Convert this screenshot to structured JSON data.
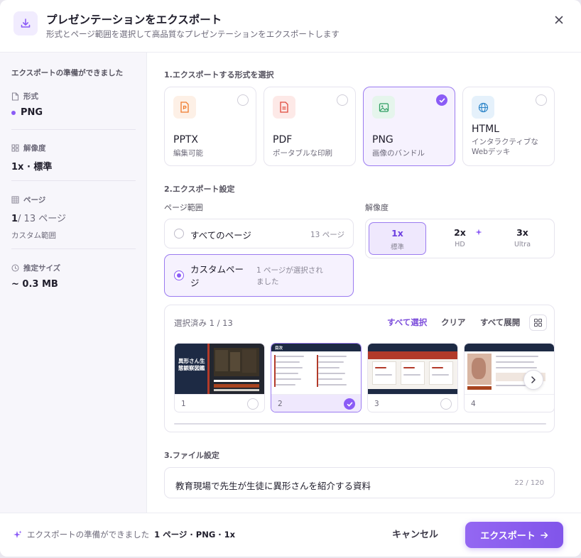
{
  "header": {
    "title": "プレゼンテーションをエクスポート",
    "subtitle": "形式とページ範囲を選択して高品質なプレゼンテーションをエクスポートします"
  },
  "sidebar": {
    "heading": "エクスポートの準備ができました",
    "format_label": "形式",
    "format_value": "PNG",
    "resolution_label": "解像度",
    "resolution_value": "1x · 標準",
    "pages_label": "ページ",
    "pages_selected": "1",
    "pages_total": "/ 13 ページ",
    "pages_mode": "カスタム範囲",
    "size_label": "推定サイズ",
    "size_value": "~ 0.3 MB"
  },
  "sections": {
    "format": "1.エクスポートする形式を選択",
    "settings": "2.エクスポート設定",
    "file": "3.ファイル設定"
  },
  "formats": [
    {
      "name": "PPTX",
      "desc": "編集可能",
      "selected": false,
      "color": "#f07a2c",
      "bg": "#fdf0e6"
    },
    {
      "name": "PDF",
      "desc": "ポータブルな印刷",
      "selected": false,
      "color": "#e0473b",
      "bg": "#fde9e7"
    },
    {
      "name": "PNG",
      "desc": "画像のバンドル",
      "selected": true,
      "color": "#2f9e62",
      "bg": "#e5f5ec"
    },
    {
      "name": "HTML",
      "desc": "インタラクティブなWebデッキ",
      "selected": false,
      "color": "#2b84c8",
      "bg": "#e5f1fb"
    }
  ],
  "range": {
    "label": "ページ範囲",
    "all_label": "すべてのページ",
    "all_count": "13 ページ",
    "custom_label": "カスタムページ",
    "custom_meta": "1 ページが選択されました"
  },
  "resolution": {
    "label": "解像度",
    "options": [
      {
        "value": "1x",
        "sub": "標準",
        "selected": true
      },
      {
        "value": "2x",
        "sub": "HD",
        "selected": false
      },
      {
        "value": "3x",
        "sub": "Ultra",
        "selected": false
      }
    ]
  },
  "thumbs": {
    "count": "選択済み 1 / 13",
    "select_all": "すべて選択",
    "clear": "クリア",
    "expand_all": "すべて展開",
    "slide1_title": "異形さん生態観察図鑑",
    "slide2_header": "目次",
    "pages": [
      {
        "num": "1",
        "selected": false
      },
      {
        "num": "2",
        "selected": true
      },
      {
        "num": "3",
        "selected": false
      },
      {
        "num": "4",
        "selected": false
      }
    ]
  },
  "file": {
    "name": "教育現場で先生が生徒に異形さんを紹介する資料",
    "count": "22 / 120"
  },
  "footer": {
    "status_prefix": "エクスポートの準備ができました",
    "status_detail": "1 ページ · PNG · 1x",
    "cancel": "キャンセル",
    "export": "エクスポート"
  },
  "colors": {
    "accent": "#8b5cf6",
    "accent_dark": "#7c4ddb"
  }
}
